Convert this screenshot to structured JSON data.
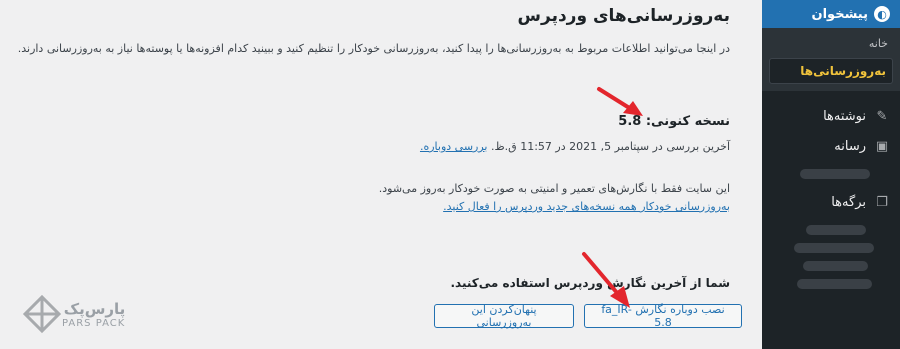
{
  "main": {
    "title": "به‌روزرسانی‌های وردپرس",
    "intro": "در اینجا می‌توانید اطلاعات مربوط به به‌روزرسانی‌ها را پیدا کنید، به‌روزرسانی خودکار را تنظیم کنید و ببینید کدام افزونه‌ها یا پوسته‌ها نیاز به به‌روزرسانی دارند.",
    "current_version": "نسخه کنونی: 5.8",
    "last_checked": "آخرین بررسی در سپتامبر 5, 2021 در 11:57 ق.ظ.",
    "check_again": "بررسی دوباره.",
    "security_note": "این سایت فقط با نگارش‌های تعمیر و امنیتی به صورت خودکار به‌روز می‌شود.",
    "enable_auto": "به‌روزرسانی خودکار همه نسخه‌های جدید وردپرس را فعال کنید.",
    "latest_notice": "شما از آخرین نگارش وردپرس استفاده می‌کنید.",
    "reinstall_button": "نصب دوباره نگارش fa_IR-5.8",
    "hide_button": "پنهان‌کردن این به‌روزرسانی"
  },
  "sidebar": {
    "dashboard": "پیشخوان",
    "home": "خانه",
    "updates": "به‌روزرسانی‌ها",
    "posts": "نوشته‌ها",
    "media": "رسانه",
    "pages": "برگه‌ها"
  },
  "logo": {
    "fa": "پارس‌پک",
    "en": "PARS PACK"
  },
  "colors": {
    "accent": "#2271b1",
    "sidebar_bg": "#1d2327",
    "highlight": "#f0c33c",
    "arrow": "#e3262d"
  }
}
